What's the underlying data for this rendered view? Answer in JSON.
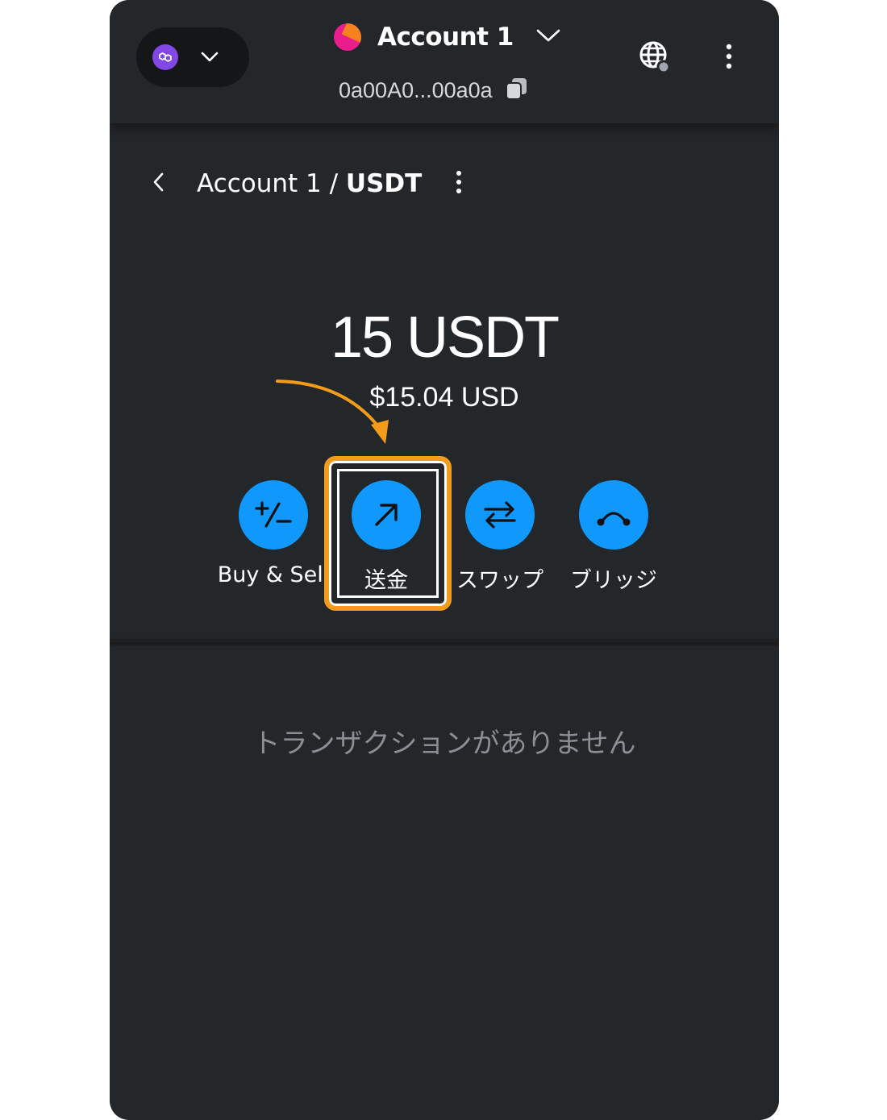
{
  "header": {
    "account_name": "Account 1",
    "address": "0a00A0...00a0a",
    "network_icon": "polygon-icon",
    "colors": {
      "background": "#24272a",
      "accent": "#1098fc",
      "highlight": "#f39c1a"
    }
  },
  "breadcrumb": {
    "account": "Account 1 / ",
    "token": "USDT"
  },
  "balance": {
    "amount": "15 USDT",
    "fiat": "$15.04 USD"
  },
  "actions": [
    {
      "label": "Buy & Sell",
      "icon": "plus-minus-icon"
    },
    {
      "label": "送金",
      "icon": "arrow-up-right-icon"
    },
    {
      "label": "スワップ",
      "icon": "swap-arrows-icon"
    },
    {
      "label": "ブリッジ",
      "icon": "bridge-icon"
    }
  ],
  "transactions": {
    "empty_message": "トランザクションがありません"
  }
}
